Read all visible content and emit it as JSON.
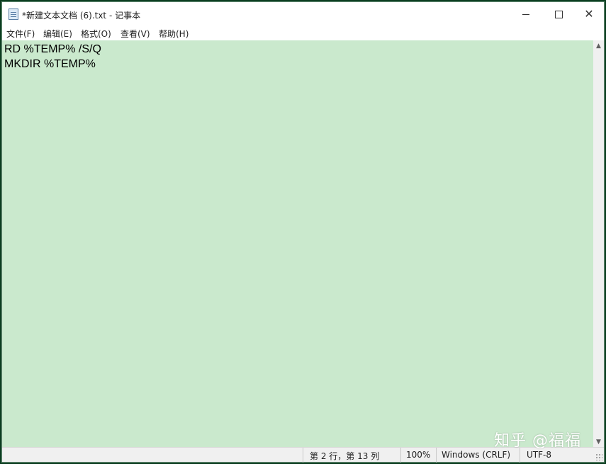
{
  "window": {
    "title": "*新建文本文档 (6).txt - 记事本",
    "icon": "notepad-icon",
    "controls": {
      "minimize": "minimize-icon",
      "maximize": "maximize-icon",
      "close_glyph": "✕"
    }
  },
  "menu": {
    "items": [
      {
        "label": "文件(F)"
      },
      {
        "label": "编辑(E)"
      },
      {
        "label": "格式(O)"
      },
      {
        "label": "查看(V)"
      },
      {
        "label": "帮助(H)"
      }
    ]
  },
  "editor": {
    "background": "#cae9cd",
    "lines": [
      "RD %TEMP% /S/Q",
      "MKDIR %TEMP%"
    ]
  },
  "scrollbar": {
    "up_glyph": "▲",
    "down_glyph": "▼"
  },
  "status": {
    "position": "第 2 行，第 13 列",
    "zoom": "100%",
    "line_ending": "Windows (CRLF)",
    "encoding": "UTF-8"
  },
  "watermark": {
    "text": "知乎 @福福"
  }
}
